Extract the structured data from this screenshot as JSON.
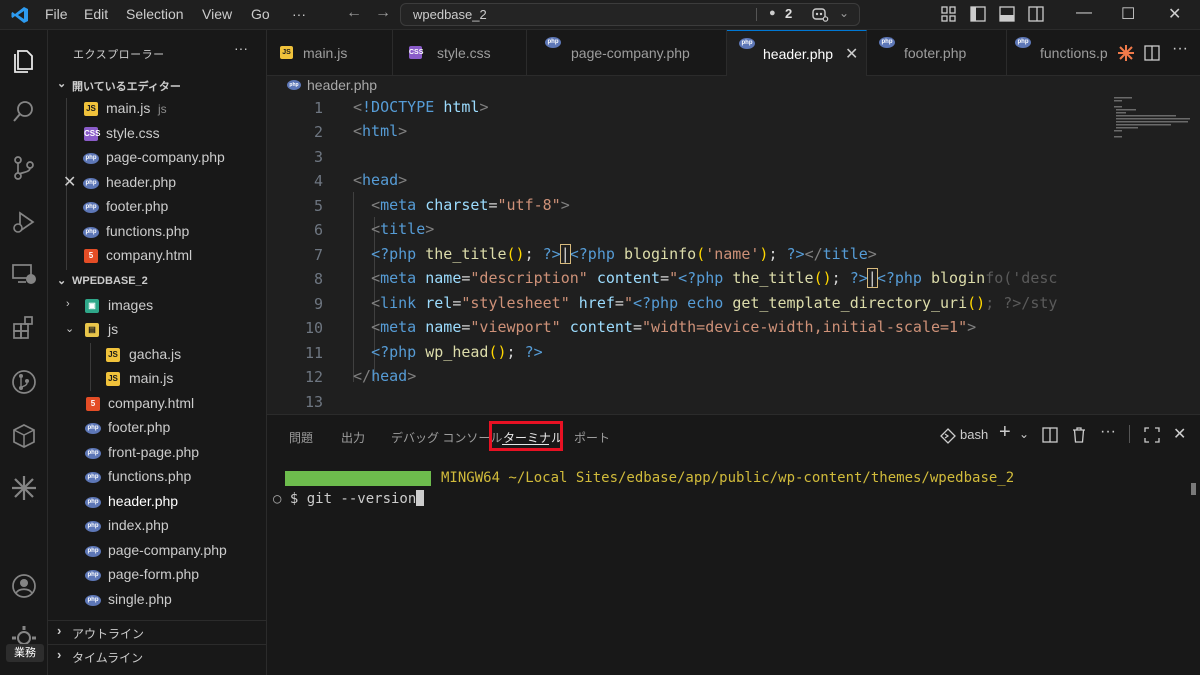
{
  "titlebar": {
    "menus": [
      "File",
      "Edit",
      "Selection",
      "View",
      "Go",
      "···"
    ],
    "search_text": "wpedbase_2",
    "count": "2",
    "count_dot": "●"
  },
  "sidebar": {
    "title": "エクスプローラー",
    "more": "···",
    "open_editors_label": "開いているエディター",
    "open_editors": [
      {
        "name": "main.js",
        "hint": "js",
        "type": "js"
      },
      {
        "name": "style.css",
        "type": "css"
      },
      {
        "name": "page-company.php",
        "type": "php"
      },
      {
        "name": "header.php",
        "type": "php",
        "close": "✕"
      },
      {
        "name": "footer.php",
        "type": "php"
      },
      {
        "name": "functions.php",
        "type": "php"
      },
      {
        "name": "company.html",
        "type": "html"
      }
    ],
    "workspace_label": "WPEDBASE_2",
    "files": [
      {
        "name": "images",
        "type": "folder-img",
        "chev": "›"
      },
      {
        "name": "js",
        "type": "folder-js",
        "chev": "⌄"
      },
      {
        "name": "gacha.js",
        "type": "js"
      },
      {
        "name": "main.js",
        "type": "js"
      },
      {
        "name": "company.html",
        "type": "html"
      },
      {
        "name": "footer.php",
        "type": "php"
      },
      {
        "name": "front-page.php",
        "type": "php"
      },
      {
        "name": "functions.php",
        "type": "php"
      },
      {
        "name": "header.php",
        "type": "php"
      },
      {
        "name": "index.php",
        "type": "php"
      },
      {
        "name": "page-company.php",
        "type": "php"
      },
      {
        "name": "page-form.php",
        "type": "php"
      },
      {
        "name": "single.php",
        "type": "php"
      }
    ],
    "outline_label": "アウトライン",
    "timeline_label": "タイムライン"
  },
  "activity": {
    "badge": "業務"
  },
  "tabs": [
    {
      "name": "main.js",
      "type": "js"
    },
    {
      "name": "style.css",
      "type": "css"
    },
    {
      "name": "page-company.php",
      "type": "php"
    },
    {
      "name": "header.php",
      "type": "php",
      "active": true,
      "close": "✕"
    },
    {
      "name": "footer.php",
      "type": "php"
    },
    {
      "name": "functions.p",
      "type": "php"
    }
  ],
  "breadcrumb": "header.php",
  "editor": {
    "line_numbers": [
      "1",
      "2",
      "3",
      "4",
      "5",
      "6",
      "7",
      "8",
      "9",
      "10",
      "11",
      "12",
      "13"
    ]
  },
  "panel": {
    "tabs": [
      "問題",
      "出力",
      "デバッグ コンソール",
      "ターミナル",
      "ポート"
    ],
    "shell": "bash",
    "terminal_host": "MINGW64 ~/Local Sites/edbase/app/public/wp-content/themes/wpedbase_2",
    "terminal_prompt": "$ git --version"
  },
  "icon_names": [
    "explorer-icon",
    "search-icon",
    "source-control-icon",
    "run-debug-icon",
    "remote-explorer-icon",
    "extensions-icon",
    "git-graph-icon",
    "package-icon",
    "spark-icon",
    "account-icon",
    "settings-gear-icon"
  ]
}
